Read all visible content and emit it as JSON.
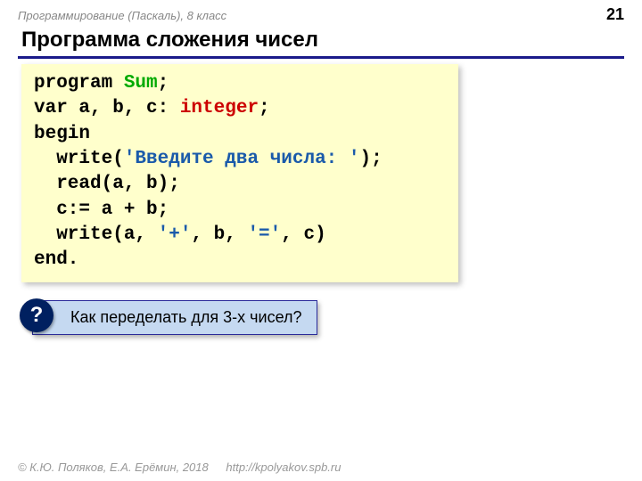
{
  "header": {
    "subject": "Программирование (Паскаль), 8 класс",
    "pagenum": "21"
  },
  "title": "Программа сложения чисел",
  "code": {
    "l1a": "program ",
    "l1b": "Sum",
    "l1c": ";",
    "l2a": "var a, b, c: ",
    "l2b": "integer",
    "l2c": ";",
    "l3": "begin",
    "l4a": "write(",
    "l4b": "'Введите два числа: '",
    "l4c": ");",
    "l5": "read(a, b);",
    "l6": "c:= a + b;",
    "l7a": "write(a, ",
    "l7b": "'+'",
    "l7c": ", b, ",
    "l7d": "'='",
    "l7e": ", c)",
    "l8": "end."
  },
  "question": {
    "badge": "?",
    "text": "Как переделать для 3-х чисел?"
  },
  "footer": {
    "credit": "© К.Ю. Поляков, Е.А. Ерёмин, 2018",
    "url": "http://kpolyakov.spb.ru"
  }
}
